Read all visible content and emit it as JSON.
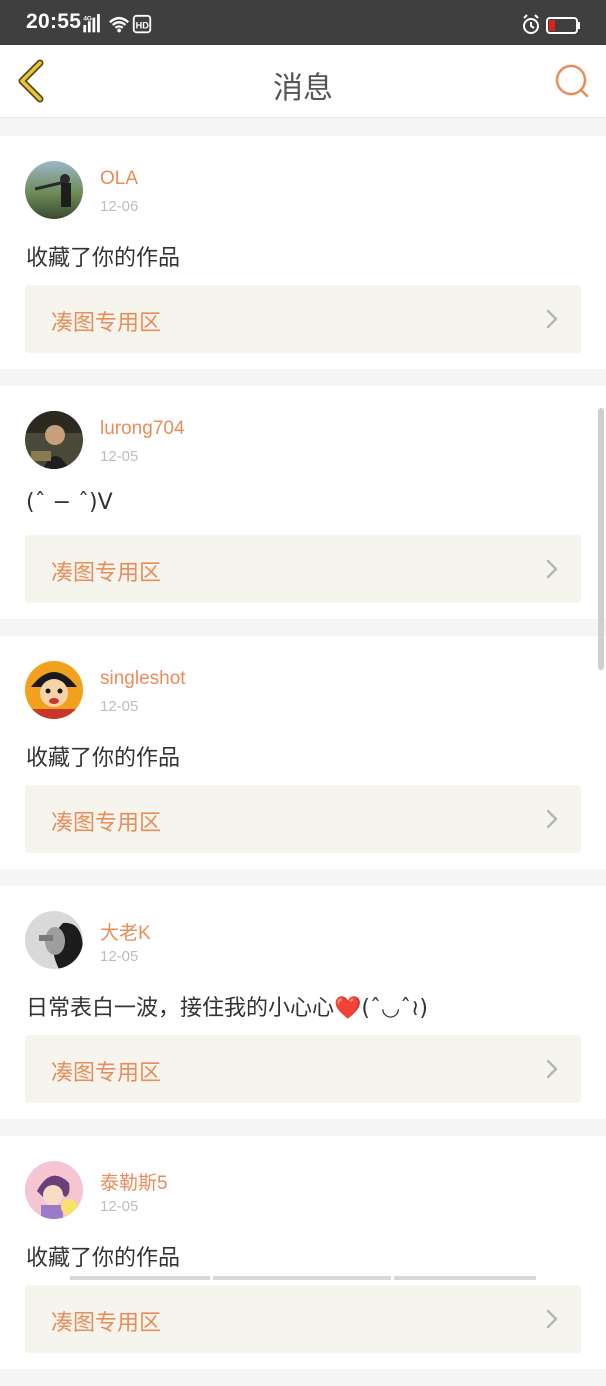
{
  "status_bar": {
    "time": "20:55",
    "network_badge": "4G",
    "hd_badge": "HD"
  },
  "nav": {
    "title": "消息"
  },
  "messages": [
    {
      "username": "OLA",
      "date": "12-06",
      "text": "收藏了你的作品",
      "link_label": "凑图专用区",
      "avatar_colors": [
        "#3a4a2e",
        "#6e8b58"
      ]
    },
    {
      "username": "lurong704",
      "date": "12-05",
      "text": "(ˆ − ˆ)V",
      "link_label": "凑图专用区",
      "avatar_colors": [
        "#2c2a20",
        "#8a7a52"
      ]
    },
    {
      "username": "singleshot",
      "date": "12-05",
      "text": "收藏了你的作品",
      "link_label": "凑图专用区",
      "avatar_colors": [
        "#f2a11d",
        "#c9362c"
      ]
    },
    {
      "username": "大老K",
      "date": "12-05",
      "text": "日常表白一波，接住我的小心心❤️(ˆ◡ˆ≀)",
      "link_label": "凑图专用区",
      "avatar_colors": [
        "#1c1c1c",
        "#d9d9d9"
      ]
    },
    {
      "username": "泰勒斯5",
      "date": "12-05",
      "text": "收藏了你的作品",
      "link_label": "凑图专用区",
      "avatar_colors": [
        "#f5c6d2",
        "#6a3f7a"
      ]
    }
  ],
  "colors": {
    "accent": "#e98d5a",
    "back_icon": "#e8c53a",
    "status_bar": "#3f3f3f"
  }
}
